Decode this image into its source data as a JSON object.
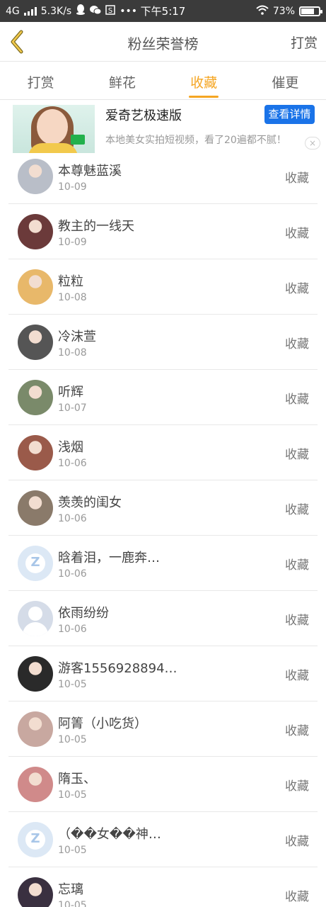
{
  "status_bar": {
    "network": "4G",
    "speed": "5.3K/s",
    "time": "下午5:17",
    "battery": "73%",
    "icons": [
      "signal-icon",
      "qq-icon",
      "wechat-icon",
      "s-icon",
      "more-icon",
      "wifi-icon",
      "battery-icon"
    ]
  },
  "header": {
    "title": "粉丝荣誉榜",
    "right_button": "打赏",
    "back_icon": "chevron-left-icon"
  },
  "tabs": [
    {
      "label": "打赏",
      "active": false
    },
    {
      "label": "鲜花",
      "active": false
    },
    {
      "label": "收藏",
      "active": true
    },
    {
      "label": "催更",
      "active": false
    }
  ],
  "ad": {
    "title": "爱奇艺极速版",
    "button": "查看详情",
    "description": "本地美女实拍短视频，看了20遍都不腻！",
    "close": "×"
  },
  "accent_color": "#f5a623",
  "list": [
    {
      "name": "本尊魅蓝溪",
      "date": "10-09",
      "action": "收藏",
      "avatar": "photo",
      "color": "#b9bec8"
    },
    {
      "name": "教主的一线天",
      "date": "10-09",
      "action": "收藏",
      "avatar": "photo",
      "color": "#6b3a3a"
    },
    {
      "name": "粒粒",
      "date": "10-08",
      "action": "收藏",
      "avatar": "photo",
      "color": "#e8b86a"
    },
    {
      "name": "冷沫萱",
      "date": "10-08",
      "action": "收藏",
      "avatar": "photo",
      "color": "#555555"
    },
    {
      "name": "听辉",
      "date": "10-07",
      "action": "收藏",
      "avatar": "photo",
      "color": "#7a8a6a"
    },
    {
      "name": "浅烟",
      "date": "10-06",
      "action": "收藏",
      "avatar": "photo",
      "color": "#9a5a4a"
    },
    {
      "name": "羡羡的闺女",
      "date": "10-06",
      "action": "收藏",
      "avatar": "photo",
      "color": "#8a7a6a"
    },
    {
      "name": "晗着泪，一鹿奔…",
      "date": "10-06",
      "action": "收藏",
      "avatar": "default"
    },
    {
      "name": "依雨纷纷",
      "date": "10-06",
      "action": "收藏",
      "avatar": "person"
    },
    {
      "name": "游客1556928894…",
      "date": "10-05",
      "action": "收藏",
      "avatar": "photo",
      "color": "#2a2a2a"
    },
    {
      "name": "阿箐（小吃货）",
      "date": "10-05",
      "action": "收藏",
      "avatar": "photo",
      "color": "#c8a8a0"
    },
    {
      "name": "隋玉、",
      "date": "10-05",
      "action": "收藏",
      "avatar": "photo",
      "color": "#d08a8a"
    },
    {
      "name": "（��女��神…",
      "date": "10-05",
      "action": "收藏",
      "avatar": "default"
    },
    {
      "name": "忘璃",
      "date": "10-05",
      "action": "收藏",
      "avatar": "photo",
      "color": "#3a3040"
    }
  ]
}
